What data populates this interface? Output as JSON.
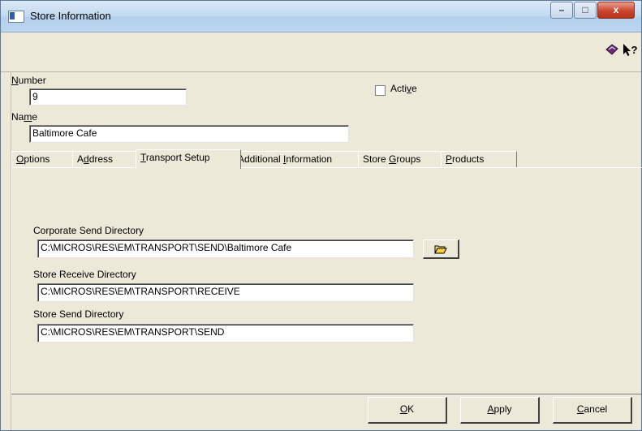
{
  "window": {
    "title": "Store Information",
    "controls": {
      "minimize": "–",
      "maximize": "□",
      "close": "x"
    }
  },
  "toolbar": {
    "icons": [
      "book-icon",
      "context-help-icon"
    ]
  },
  "form": {
    "number": {
      "label_accel": "N",
      "label_rest": "umber",
      "value": "9"
    },
    "active": {
      "label_pre": "Acti",
      "label_accel": "v",
      "label_post": "e",
      "checked": false
    },
    "name": {
      "label_pre": "Na",
      "label_accel": "m",
      "label_post": "e",
      "value": "Baltimore Cafe"
    }
  },
  "tabs": [
    {
      "pre": "",
      "accel": "O",
      "post": "ptions"
    },
    {
      "pre": "A",
      "accel": "d",
      "post": "dress"
    },
    {
      "pre": "",
      "accel": "T",
      "post": "ransport Setup"
    },
    {
      "pre": "Additional ",
      "accel": "I",
      "post": "nformation"
    },
    {
      "pre": "Store ",
      "accel": "G",
      "post": "roups"
    },
    {
      "pre": "",
      "accel": "P",
      "post": "roducts"
    }
  ],
  "active_tab": "Transport Setup",
  "transport": {
    "corporate_send": {
      "label": "Corporate Send Directory",
      "value": "C:\\MICROS\\RES\\EM\\TRANSPORT\\SEND\\Baltimore Cafe"
    },
    "store_receive": {
      "label": "Store Receive Directory",
      "value": "C:\\MICROS\\RES\\EM\\TRANSPORT\\RECEIVE"
    },
    "store_send": {
      "label": "Store Send Directory",
      "value": "C:\\MICROS\\RES\\EM\\TRANSPORT\\SEND"
    }
  },
  "buttons": {
    "ok": {
      "accel": "O",
      "post": "K"
    },
    "apply": {
      "accel": "A",
      "post": "pply"
    },
    "cancel": {
      "accel": "C",
      "post": "ancel"
    }
  }
}
